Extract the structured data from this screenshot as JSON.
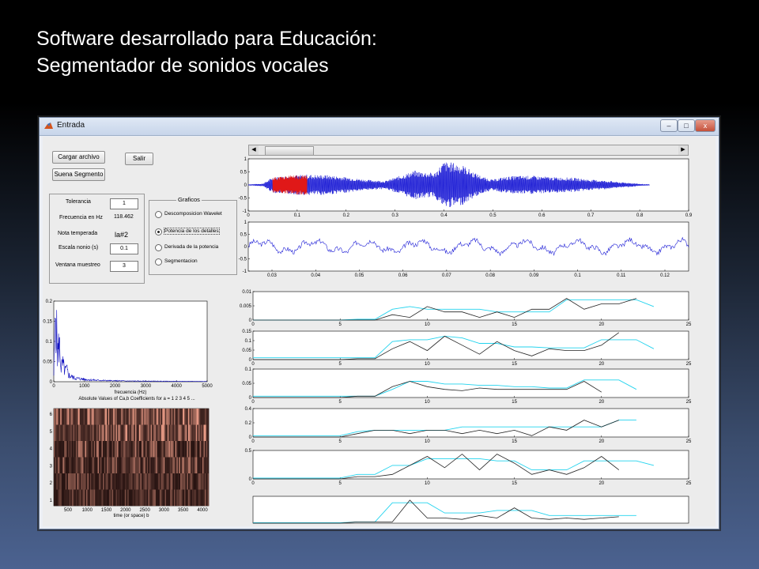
{
  "slide": {
    "title_line1": "Software desarrollado para Educación:",
    "title_line2": "Segmentador de sonidos vocales"
  },
  "window": {
    "title": "Entrada",
    "minimize": "–",
    "maximize": "□",
    "close": "x"
  },
  "buttons": {
    "load": "Cargar archivo",
    "exit": "Salir",
    "play": "Suena Segmento"
  },
  "params": {
    "tolerance_label": "Tolerancia",
    "tolerance_value": "1",
    "frequency_label": "Frecuencia en Hz",
    "frequency_value": "118.462",
    "note_label": "Nota temperada",
    "note_value": "la#2",
    "nonius_label": "Escala nonio (s)",
    "nonius_value": "0.1",
    "window_label": "Ventana muestreo",
    "window_value": "3"
  },
  "graphics": {
    "title": "Graficos",
    "options": [
      {
        "label": "Descomposicion Wavelet",
        "selected": false
      },
      {
        "label": "Potencia de los detalles",
        "selected": true
      },
      {
        "label": "Derivada de la potencia",
        "selected": false
      },
      {
        "label": "Segmentacion",
        "selected": false
      }
    ]
  },
  "colors": {
    "signal": "#1f1fd6",
    "highlight": "#e01818",
    "cyan": "#22d3ee",
    "black": "#222222",
    "spectrum": "#1010c0"
  },
  "chart_data": [
    {
      "id": "waveform",
      "type": "line",
      "xlim": [
        0,
        0.9
      ],
      "ylim": [
        -1,
        1
      ],
      "xticks": [
        "0",
        "0.1",
        "0.2",
        "0.3",
        "0.4",
        "0.5",
        "0.6",
        "0.7",
        "0.8",
        "0.9"
      ],
      "yticks": [
        "1",
        "0.5",
        "0",
        "-0.5",
        "-1"
      ],
      "envelope": {
        "x": [
          0,
          0.03,
          0.05,
          0.08,
          0.12,
          0.16,
          0.2,
          0.24,
          0.28,
          0.31,
          0.34,
          0.36,
          0.38,
          0.4,
          0.42,
          0.44,
          0.46,
          0.48,
          0.5,
          0.52,
          0.55,
          0.58,
          0.62,
          0.66,
          0.7,
          0.74,
          0.76,
          0.78,
          0.8,
          0.82
        ],
        "amp": [
          0.02,
          0.05,
          0.3,
          0.35,
          0.4,
          0.38,
          0.3,
          0.2,
          0.15,
          0.35,
          0.55,
          0.5,
          0.45,
          0.9,
          0.85,
          0.75,
          0.5,
          0.3,
          0.2,
          0.3,
          0.35,
          0.35,
          0.3,
          0.28,
          0.2,
          0.15,
          0.1,
          0.08,
          0.04,
          0.02
        ]
      },
      "highlight_range": [
        0.05,
        0.12
      ]
    },
    {
      "id": "zoom",
      "type": "line",
      "xlim": [
        0.025,
        0.125
      ],
      "ylim": [
        -1,
        1
      ],
      "xticks": [
        "0.03",
        "0.04",
        "0.05",
        "0.06",
        "0.07",
        "0.08",
        "0.09",
        "0.1",
        "0.11",
        "0.12"
      ],
      "yticks": [
        "1",
        "0.5",
        "0",
        "-0.5",
        "-1"
      ]
    },
    {
      "id": "spectrum",
      "type": "line",
      "title": "",
      "xlim": [
        0,
        5000
      ],
      "ylim": [
        0,
        0.22
      ],
      "xticks": [
        "0",
        "1000",
        "2000",
        "3000",
        "4000",
        "5000"
      ],
      "yticks": [
        "0.2",
        "0.15",
        "0.1",
        "0.05",
        "0"
      ],
      "xlabel": "frecuencia (Hz)",
      "x": [
        0,
        60,
        120,
        180,
        240,
        300,
        360,
        420,
        480,
        560,
        700,
        900,
        1100,
        1400,
        1800,
        2400,
        3200,
        4200,
        5000
      ],
      "y": [
        0.02,
        0.21,
        0.08,
        0.11,
        0.04,
        0.05,
        0.03,
        0.035,
        0.02,
        0.015,
        0.01,
        0.008,
        0.006,
        0.004,
        0.003,
        0.002,
        0.0015,
        0.001,
        0.001
      ]
    },
    {
      "id": "scalogram",
      "type": "heatmap",
      "title": "Absolute Values of Ca,b Coefficients for a = 1 2 3 4 5 ...",
      "xlabel": "time (or space) b",
      "xticks": [
        "500",
        "1000",
        "1500",
        "2000",
        "2500",
        "3000",
        "3500",
        "4000"
      ],
      "yticks": [
        "6",
        "5",
        "4",
        "3",
        "2",
        "1"
      ]
    },
    {
      "id": "power",
      "type": "line",
      "xlim": [
        0,
        25
      ],
      "xticks": [
        "0",
        "5",
        "10",
        "15",
        "20",
        "25"
      ],
      "panels": [
        {
          "yticks": [
            "0.01",
            "0.005",
            "0"
          ],
          "ymax": 0.01,
          "black": [
            0,
            0,
            0,
            0,
            0,
            0,
            0,
            0,
            0.002,
            0.001,
            0.005,
            0.003,
            0.003,
            0.001,
            0.003,
            0.001,
            0.004,
            0.004,
            0.008,
            0.004,
            0.006,
            0.006,
            0.008
          ],
          "cyan": [
            0,
            0,
            0,
            0,
            0,
            0,
            0.0003,
            0.0003,
            0.004,
            0.005,
            0.004,
            0.004,
            0.004,
            0.004,
            0.003,
            0.003,
            0.003,
            0.003,
            0.0075,
            0.0075,
            0.0075,
            0.0075,
            0.0075,
            0.005
          ]
        },
        {
          "yticks": [
            "0.15",
            "0.1",
            "0.05",
            "0"
          ],
          "ymax": 0.15,
          "black": [
            0,
            0,
            0,
            0,
            0,
            0,
            0.005,
            0.005,
            0.06,
            0.1,
            0.05,
            0.13,
            0.08,
            0.03,
            0.1,
            0.05,
            0.02,
            0.06,
            0.05,
            0.05,
            0.08,
            0.15
          ],
          "cyan": [
            0.01,
            0.01,
            0.01,
            0.01,
            0.01,
            0.01,
            0.01,
            0.01,
            0.1,
            0.11,
            0.11,
            0.13,
            0.12,
            0.09,
            0.09,
            0.07,
            0.07,
            0.065,
            0.065,
            0.065,
            0.11,
            0.11,
            0.11,
            0.06
          ]
        },
        {
          "yticks": [
            "0.1",
            "0.05",
            "0"
          ],
          "ymax": 0.1,
          "black": [
            0,
            0,
            0,
            0,
            0,
            0,
            0.005,
            0.005,
            0.04,
            0.06,
            0.04,
            0.03,
            0.025,
            0.035,
            0.03,
            0.03,
            0.03,
            0.03,
            0.03,
            0.06,
            0.02
          ],
          "cyan": [
            0.005,
            0.005,
            0.005,
            0.005,
            0.005,
            0.005,
            0.005,
            0.005,
            0.03,
            0.06,
            0.06,
            0.05,
            0.05,
            0.045,
            0.045,
            0.04,
            0.04,
            0.035,
            0.035,
            0.065,
            0.065,
            0.065,
            0.03
          ]
        },
        {
          "yticks": [
            "0.4",
            "0.2",
            "0"
          ],
          "ymax": 0.4,
          "black": [
            0,
            0,
            0,
            0,
            0,
            0,
            0.05,
            0.1,
            0.1,
            0.05,
            0.1,
            0.1,
            0.05,
            0.1,
            0.05,
            0.1,
            0.02,
            0.15,
            0.1,
            0.25,
            0.15,
            0.25
          ],
          "cyan": [
            0.02,
            0.02,
            0.02,
            0.02,
            0.02,
            0.02,
            0.08,
            0.1,
            0.1,
            0.1,
            0.1,
            0.1,
            0.15,
            0.15,
            0.15,
            0.15,
            0.15,
            0.15,
            0.15,
            0.15,
            0.15,
            0.25,
            0.25
          ]
        },
        {
          "yticks": [
            "0.5",
            "0"
          ],
          "ymax": 0.6,
          "black": [
            0,
            0,
            0,
            0,
            0,
            0,
            0.05,
            0.05,
            0.1,
            0.3,
            0.5,
            0.25,
            0.55,
            0.2,
            0.55,
            0.35,
            0.1,
            0.2,
            0.1,
            0.25,
            0.5,
            0.2
          ],
          "cyan": [
            0.02,
            0.02,
            0.02,
            0.02,
            0.02,
            0.02,
            0.1,
            0.1,
            0.3,
            0.3,
            0.45,
            0.45,
            0.45,
            0.45,
            0.4,
            0.4,
            0.2,
            0.2,
            0.2,
            0.4,
            0.4,
            0.4,
            0.4,
            0.3
          ]
        },
        {
          "yticks": [],
          "ymax": 1,
          "black": [
            0,
            0,
            0,
            0,
            0,
            0,
            0.05,
            0.05,
            0.05,
            0.9,
            0.2,
            0.2,
            0.15,
            0.3,
            0.2,
            0.6,
            0.2,
            0.15,
            0.2,
            0.15,
            0.2,
            0.25
          ],
          "cyan": [
            0.02,
            0.02,
            0.02,
            0.02,
            0.02,
            0.02,
            0.05,
            0.05,
            0.8,
            0.8,
            0.8,
            0.4,
            0.4,
            0.4,
            0.5,
            0.5,
            0.5,
            0.3,
            0.3,
            0.3,
            0.3,
            0.3,
            0.3
          ]
        }
      ]
    }
  ]
}
